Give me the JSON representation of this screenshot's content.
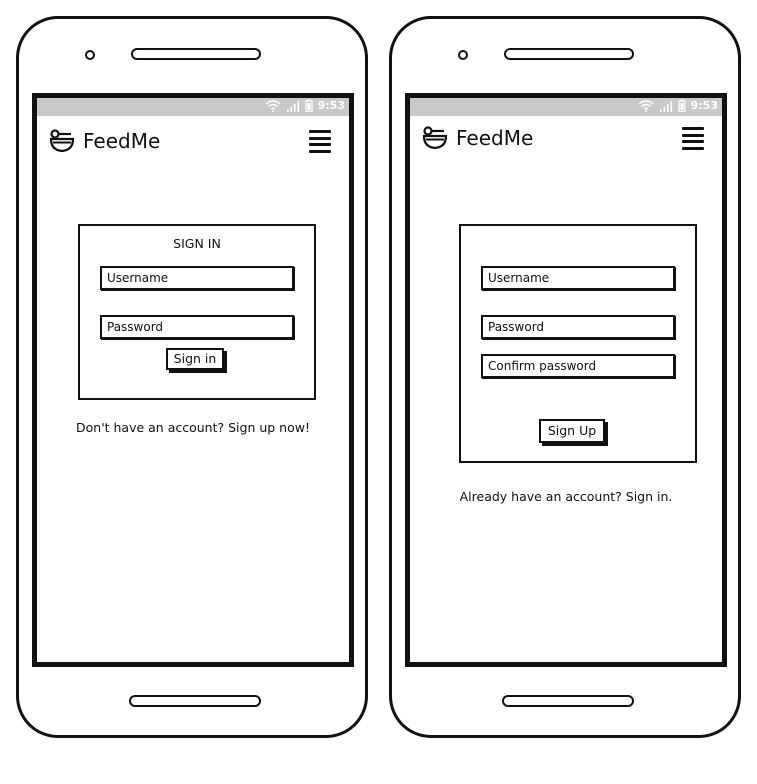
{
  "signin_screen": {
    "status": {
      "time": "9:53"
    },
    "brand": "FeedMe",
    "title": "SIGN IN",
    "username_placeholder": "Username",
    "password_placeholder": "Password",
    "submit_label": "Sign in",
    "footer_link": "Don't have an account? Sign up now!"
  },
  "signup_screen": {
    "status": {
      "time": "9:53"
    },
    "brand": "FeedMe",
    "username_placeholder": "Username",
    "password_placeholder": "Password",
    "confirm_placeholder": "Confirm password",
    "submit_label": "Sign Up",
    "footer_link": "Already have an account? Sign in."
  },
  "icons": {
    "logo": "bowl-logo-icon",
    "menu": "hamburger-menu-icon",
    "wifi": "wifi-icon",
    "signal": "signal-icon",
    "battery": "battery-icon"
  }
}
